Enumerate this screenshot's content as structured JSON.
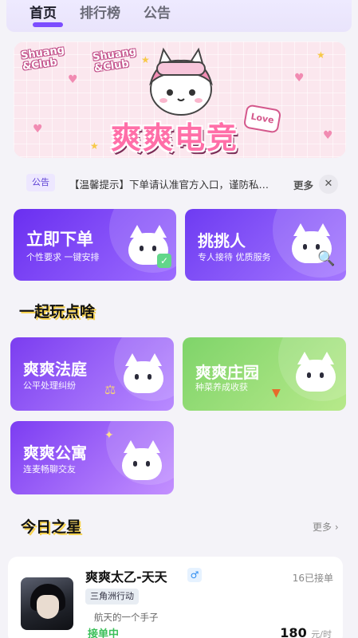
{
  "tabs": [
    {
      "label": "首页",
      "active": true
    },
    {
      "label": "排行榜",
      "active": false
    },
    {
      "label": "公告",
      "active": false
    }
  ],
  "banner": {
    "club_line1": "Shuang",
    "club_line2": "&Club",
    "title": "爽爽电竞",
    "love_tag": "Love"
  },
  "notice": {
    "badge": "公告",
    "text": "【温馨提示】下单请认准官方入口，谨防私…",
    "more": "更多",
    "close_icon": "close-icon"
  },
  "cards": {
    "order": {
      "title": "立即下单",
      "subtitle": "个性要求 一键安排",
      "color_from": "#6a2ff0",
      "color_to": "#9c6cff"
    },
    "pick": {
      "title": "挑挑人",
      "subtitle": "专人接待 优质服务",
      "color_from": "#6e3bf2",
      "color_to": "#a477ff"
    },
    "court": {
      "title": "爽爽法庭",
      "subtitle": "公平处理纠纷",
      "color_from": "#7b3df0",
      "color_to": "#b98bff"
    },
    "farm": {
      "title": "爽爽庄园",
      "subtitle": "种菜养成收获",
      "color_from": "#7fd46a",
      "color_to": "#b7e98a"
    },
    "apartment": {
      "title": "爽爽公寓",
      "subtitle": "连麦畅聊交友",
      "color_from": "#7c3df2",
      "color_to": "#c390ff"
    }
  },
  "sections": {
    "play": "一起玩点啥",
    "stars": "今日之星",
    "stars_more": "更多 ›"
  },
  "star": {
    "name": "爽爽太乙-天天",
    "gender_icon": "♂",
    "orders": "16已接单",
    "game": "三角洲行动",
    "desc": "航天的一个手子",
    "status": "接单中",
    "price": "180",
    "price_unit": "元/时"
  }
}
